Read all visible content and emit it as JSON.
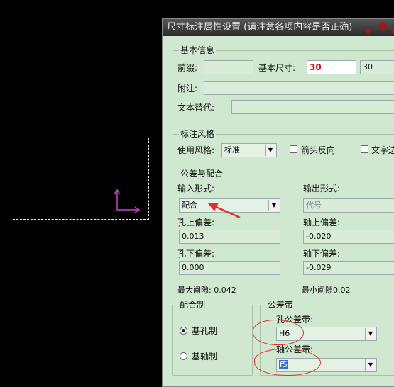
{
  "dialog": {
    "title": "尺寸标注属性设置 (请注意各项内容是否正确)",
    "basic": {
      "legend": "基本信息",
      "prefix_label": "前缀:",
      "prefix_value": "",
      "base_size_label": "基本尺寸:",
      "base_size_value": "30",
      "base_size_alt": "30",
      "note_label": "附注:",
      "note_value": "",
      "text_replace_label": "文本替代:",
      "text_replace_value": ""
    },
    "style": {
      "legend": "标注风格",
      "use_style_label": "使用风格:",
      "use_style_value": "标准",
      "arrow_reverse_label": "箭头反向",
      "text_partial_label": "文字边"
    },
    "tolerance": {
      "legend": "公差与配合",
      "input_form_label": "输入形式:",
      "input_form_value": "配合",
      "output_form_label": "输出形式:",
      "output_form_value": "代号",
      "hole_upper_label": "孔上偏差:",
      "hole_upper_value": "0.013",
      "shaft_upper_label": "轴上偏差:",
      "shaft_upper_value": "-0.020",
      "hole_lower_label": "孔下偏差:",
      "hole_lower_value": "0.000",
      "shaft_lower_label": "轴下偏差:",
      "shaft_lower_value": "-0.029",
      "max_gap_text": "最大间隙: 0.042",
      "min_gap_text": "最小间隙0.02"
    },
    "fit_system": {
      "legend": "配合制",
      "hole_basis_label": "基孔制",
      "shaft_basis_label": "基轴制",
      "selected": "基孔制"
    },
    "tol_zone": {
      "legend": "公差带",
      "hole_zone_label": "孔公差带:",
      "hole_zone_value": "H6",
      "shaft_zone_label": "轴公差带:",
      "shaft_zone_value": "f5"
    }
  },
  "colors": {
    "dialog_bg": "#cfe8cf",
    "annotation_red": "#e03030",
    "cad_axis": "#c0407a",
    "ucs": "#cc44cc"
  }
}
